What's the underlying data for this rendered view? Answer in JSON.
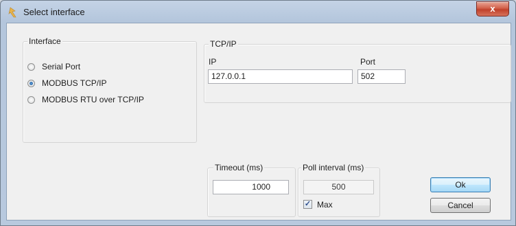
{
  "window": {
    "title": "Select interface",
    "close_label": "x"
  },
  "interface_group": {
    "label": "Interface",
    "options": [
      "Serial Port",
      "MODBUS TCP/IP",
      "MODBUS RTU over TCP/IP"
    ],
    "selected": "MODBUS TCP/IP"
  },
  "tcpip_group": {
    "label": "TCP/IP",
    "ip_label": "IP",
    "ip_value": "127.0.0.1",
    "port_label": "Port",
    "port_value": "502"
  },
  "timeout_group": {
    "label": "Timeout (ms)",
    "value": "1000"
  },
  "poll_group": {
    "label": "Poll interval (ms)",
    "value": "500",
    "max_label": "Max",
    "max_checked": true
  },
  "buttons": {
    "ok": "Ok",
    "cancel": "Cancel"
  },
  "colors": {
    "title_bar": "#b8c9de",
    "close_button": "#c9523b",
    "client": "#f0f0f0"
  }
}
